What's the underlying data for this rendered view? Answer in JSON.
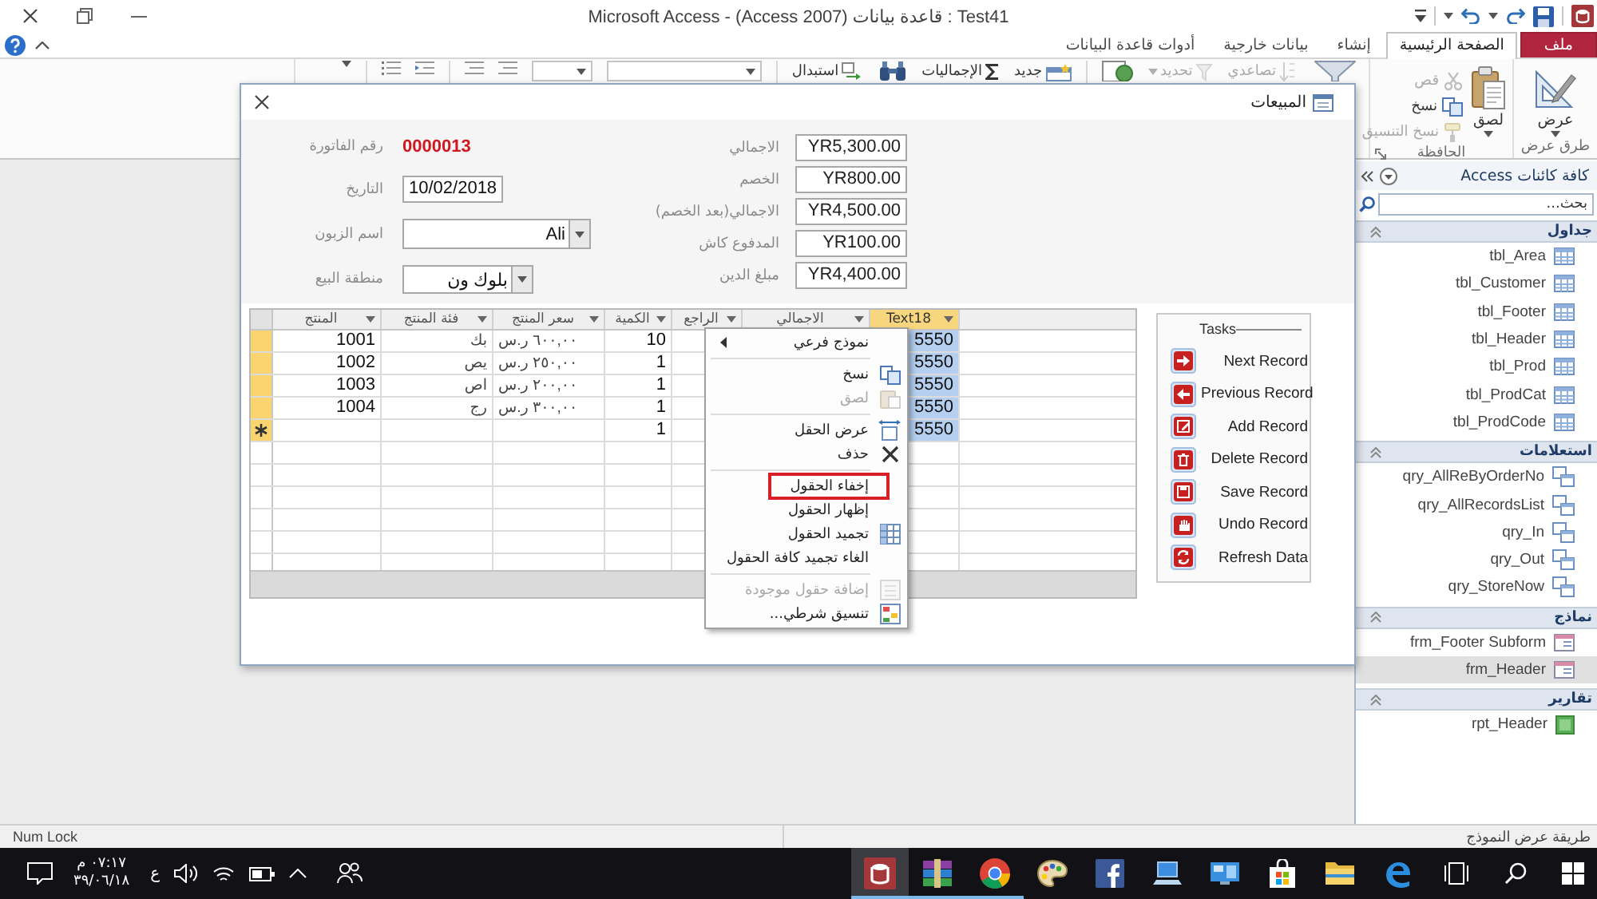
{
  "window": {
    "title": "Microsoft Access - (Access 2007) قاعدة بيانات : Test41"
  },
  "ribbon": {
    "tabs": [
      {
        "label": "ملف",
        "kind": "file",
        "selected": false
      },
      {
        "label": "الصفحة الرئيسية",
        "kind": "tab",
        "selected": true
      },
      {
        "label": "إنشاء",
        "kind": "tab",
        "selected": false
      },
      {
        "label": "بيانات خارجية",
        "kind": "tab",
        "selected": false
      },
      {
        "label": "أدوات قاعدة البيانات",
        "kind": "tab",
        "selected": false
      }
    ],
    "groups": [
      {
        "label": "طرق عرض",
        "commands": [
          {
            "label": "عرض",
            "kind": "large",
            "disabled": false
          }
        ]
      },
      {
        "label": "الحافظة",
        "commands": [
          {
            "label": "لصق",
            "kind": "large",
            "disabled": false
          },
          {
            "label": "قص",
            "kind": "small",
            "disabled": true
          },
          {
            "label": "نسخ",
            "kind": "small",
            "disabled": false
          },
          {
            "label": "نسخ التنسيق",
            "kind": "small",
            "disabled": true
          }
        ]
      }
    ],
    "toolbar_commands": [
      {
        "label": "تصاعدي",
        "disabled": true
      },
      {
        "label": "تحديد",
        "disabled": true
      },
      {
        "label": "جديد",
        "disabled": false
      },
      {
        "label": "الإجماليات",
        "disabled": false
      },
      {
        "label": "استبدال",
        "disabled": false
      }
    ]
  },
  "form": {
    "title": "المبيعات",
    "fields": [
      {
        "label": "رقم الفاتورة",
        "value": "0000013",
        "kind": "display"
      },
      {
        "label": "التاريخ",
        "value": "10/02/2018",
        "kind": "text"
      },
      {
        "label": "اسم الزبون",
        "value": "Ali",
        "kind": "combo"
      },
      {
        "label": "منطقة البيع",
        "value": "بلوك ون",
        "kind": "combo"
      }
    ],
    "totals": [
      {
        "label": "الاجمالي",
        "value": "YR5,300.00"
      },
      {
        "label": "الخصم",
        "value": "YR800.00"
      },
      {
        "label": "الاجمالي(بعد الخصم)",
        "value": "YR4,500.00"
      },
      {
        "label": "المدفوع كاش",
        "value": "YR100.00"
      },
      {
        "label": "مبلغ الدين",
        "value": "YR4,400.00"
      }
    ],
    "subform": {
      "columns": [
        {
          "label": "Text18",
          "selected": true
        },
        {
          "label": "الاجمالي",
          "selected": false
        },
        {
          "label": "الراجع",
          "selected": false
        },
        {
          "label": "الكمية",
          "selected": false
        },
        {
          "label": "سعر المنتج",
          "selected": false
        },
        {
          "label": "فئة المنتج",
          "selected": false
        },
        {
          "label": "المنتج",
          "selected": false
        }
      ],
      "rows": [
        {
          "new": false,
          "text18": "5550",
          "quantity": "10",
          "price": "٦٠٠,٠٠ ر.س",
          "category": "بك",
          "product": "1001"
        },
        {
          "new": false,
          "text18": "5550",
          "quantity": "1",
          "price": "٢٥٠,٠٠ ر.س",
          "category": "يص",
          "product": "1002"
        },
        {
          "new": false,
          "text18": "5550",
          "quantity": "1",
          "price": "٢٠٠,٠٠ ر.س",
          "category": "اص",
          "product": "1003"
        },
        {
          "new": false,
          "text18": "5550",
          "quantity": "1",
          "price": "٣٠٠,٠٠ ر.س",
          "category": "رج",
          "product": "1004"
        },
        {
          "new": true,
          "text18": "5550",
          "quantity": "1"
        }
      ]
    },
    "tasks": {
      "title": "Tasks",
      "buttons": [
        "Next Record",
        "Previous Record",
        "Add Record",
        "Delete Record",
        "Save Record",
        "Undo Record",
        "Refresh Data"
      ]
    }
  },
  "context_menu": {
    "sections": [
      {
        "items": [
          {
            "label": "نموذج فرعي",
            "submenu": true,
            "disabled": false,
            "highlighted": false
          }
        ]
      },
      {
        "items": [
          {
            "label": "نسخ",
            "submenu": false,
            "disabled": false,
            "highlighted": false
          },
          {
            "label": "لصق",
            "submenu": false,
            "disabled": true,
            "highlighted": false
          }
        ]
      },
      {
        "items": [
          {
            "label": "عرض الحقل",
            "submenu": false,
            "disabled": false,
            "highlighted": false
          },
          {
            "label": "حذف",
            "submenu": false,
            "disabled": false,
            "highlighted": false
          }
        ]
      },
      {
        "items": [
          {
            "label": "إخفاء الحقول",
            "submenu": false,
            "disabled": false,
            "highlighted": true
          },
          {
            "label": "إظهار الحقول",
            "submenu": false,
            "disabled": false,
            "highlighted": false
          },
          {
            "label": "تجميد الحقول",
            "submenu": false,
            "disabled": false,
            "highlighted": false
          },
          {
            "label": "الغاء تجميد كافة الحقول",
            "submenu": false,
            "disabled": false,
            "highlighted": false
          }
        ]
      },
      {
        "items": [
          {
            "label": "إضافة حقول موجودة",
            "submenu": false,
            "disabled": true,
            "highlighted": false
          },
          {
            "label": "تنسيق شرطي...",
            "submenu": false,
            "disabled": false,
            "highlighted": false
          }
        ]
      }
    ]
  },
  "navigation": {
    "title": "كافة كائنات Access",
    "search": {
      "placeholder": "بحث..."
    },
    "groups": [
      {
        "label": "جداول",
        "kind": "table",
        "expanded": true,
        "items": [
          {
            "label": "tbl_Area",
            "selected": false
          },
          {
            "label": "tbl_Customer",
            "selected": false
          },
          {
            "label": "tbl_Footer",
            "selected": false
          },
          {
            "label": "tbl_Header",
            "selected": false
          },
          {
            "label": "tbl_Prod",
            "selected": false
          },
          {
            "label": "tbl_ProdCat",
            "selected": false
          },
          {
            "label": "tbl_ProdCode",
            "selected": false
          }
        ]
      },
      {
        "label": "استعلامات",
        "kind": "query",
        "expanded": true,
        "items": [
          {
            "label": "qry_AllReByOrderNo",
            "selected": false
          },
          {
            "label": "qry_AllRecordsList",
            "selected": false
          },
          {
            "label": "qry_In",
            "selected": false
          },
          {
            "label": "qry_Out",
            "selected": false
          },
          {
            "label": "qry_StoreNow",
            "selected": false
          }
        ]
      },
      {
        "label": "نماذج",
        "kind": "form",
        "expanded": true,
        "items": [
          {
            "label": "frm_Footer Subform",
            "selected": false
          },
          {
            "label": "frm_Header",
            "selected": true
          }
        ]
      },
      {
        "label": "تقارير",
        "kind": "report",
        "expanded": true,
        "items": [
          {
            "label": "rpt_Header",
            "selected": false
          }
        ]
      }
    ]
  },
  "status_bar": {
    "left": "Num Lock",
    "right": "طريقة عرض النموذج"
  },
  "taskbar": {
    "clock": {
      "time": "٠٧:١٧ م",
      "date": "٣٩/٠٦/١٨"
    },
    "language": "ع",
    "apps": [
      {
        "active": true,
        "running": true
      },
      {
        "active": false,
        "running": true
      },
      {
        "active": false,
        "running": true
      },
      {
        "active": false,
        "running": false
      },
      {
        "active": false,
        "running": false
      },
      {
        "active": false,
        "running": false
      },
      {
        "active": false,
        "running": false
      },
      {
        "active": false,
        "running": false
      },
      {
        "active": false,
        "running": false
      },
      {
        "active": false,
        "running": false
      }
    ]
  }
}
